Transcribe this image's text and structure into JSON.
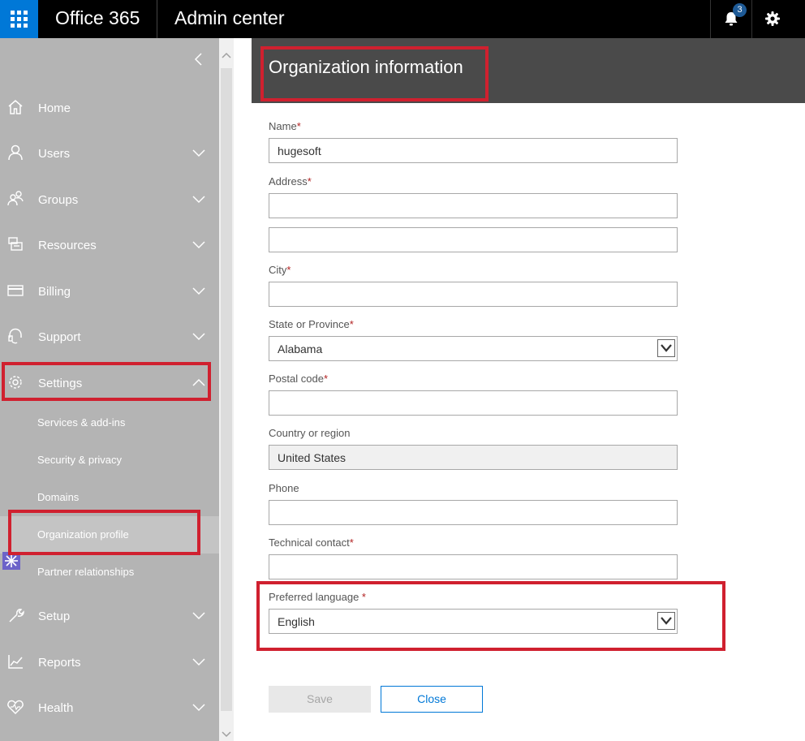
{
  "topbar": {
    "brand": "Office 365",
    "app_title": "Admin center",
    "notification_count": "3"
  },
  "sidebar": {
    "items": [
      {
        "label": "Home",
        "icon": "home-icon"
      },
      {
        "label": "Users",
        "icon": "user-icon"
      },
      {
        "label": "Groups",
        "icon": "groups-icon"
      },
      {
        "label": "Resources",
        "icon": "resources-icon"
      },
      {
        "label": "Billing",
        "icon": "billing-icon"
      },
      {
        "label": "Support",
        "icon": "headset-icon"
      },
      {
        "label": "Settings",
        "icon": "gear-icon"
      },
      {
        "label": "Setup",
        "icon": "wrench-icon"
      },
      {
        "label": "Reports",
        "icon": "chart-icon"
      },
      {
        "label": "Health",
        "icon": "heart-icon"
      }
    ],
    "settings_sub": [
      "Services & add-ins",
      "Security & privacy",
      "Domains",
      "Organization profile",
      "Partner relationships"
    ]
  },
  "panel": {
    "title": "Organization information",
    "fields": {
      "name": {
        "label": "Name",
        "value": "hugesoft"
      },
      "address": {
        "label": "Address",
        "value": "",
        "value2": ""
      },
      "city": {
        "label": "City",
        "value": ""
      },
      "state": {
        "label": "State or Province",
        "value": "Alabama"
      },
      "postal": {
        "label": "Postal code",
        "value": ""
      },
      "country": {
        "label": "Country or region",
        "value": "United States"
      },
      "phone": {
        "label": "Phone",
        "value": ""
      },
      "tech": {
        "label": "Technical contact",
        "value": ""
      },
      "language": {
        "label": "Preferred language ",
        "value": "English"
      }
    },
    "required_mark": "*",
    "save_label": "Save",
    "close_label": "Close"
  },
  "colors": {
    "accent": "#0078d7",
    "highlight": "#d0202f",
    "sidebar": "#b4b4b4",
    "header": "#4a4a4a"
  }
}
